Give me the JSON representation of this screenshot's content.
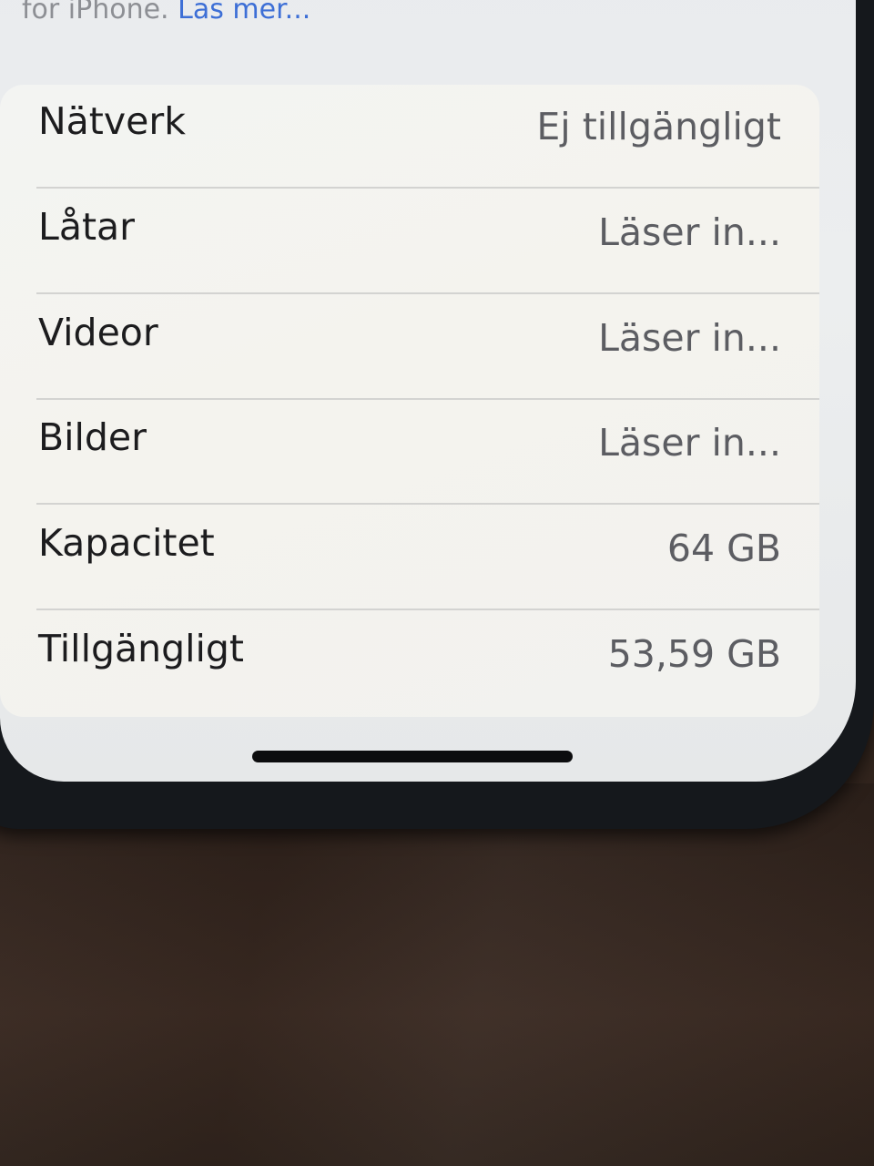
{
  "footer": {
    "text": "för iPhone.",
    "link": "Läs mer..."
  },
  "rows": [
    {
      "label": "Nätverk",
      "value": "Ej tillgängligt"
    },
    {
      "label": "Låtar",
      "value": "Läser in..."
    },
    {
      "label": "Videor",
      "value": "Läser in..."
    },
    {
      "label": "Bilder",
      "value": "Läser in..."
    },
    {
      "label": "Kapacitet",
      "value": "64 GB"
    },
    {
      "label": "Tillgängligt",
      "value": "53,59 GB"
    }
  ]
}
